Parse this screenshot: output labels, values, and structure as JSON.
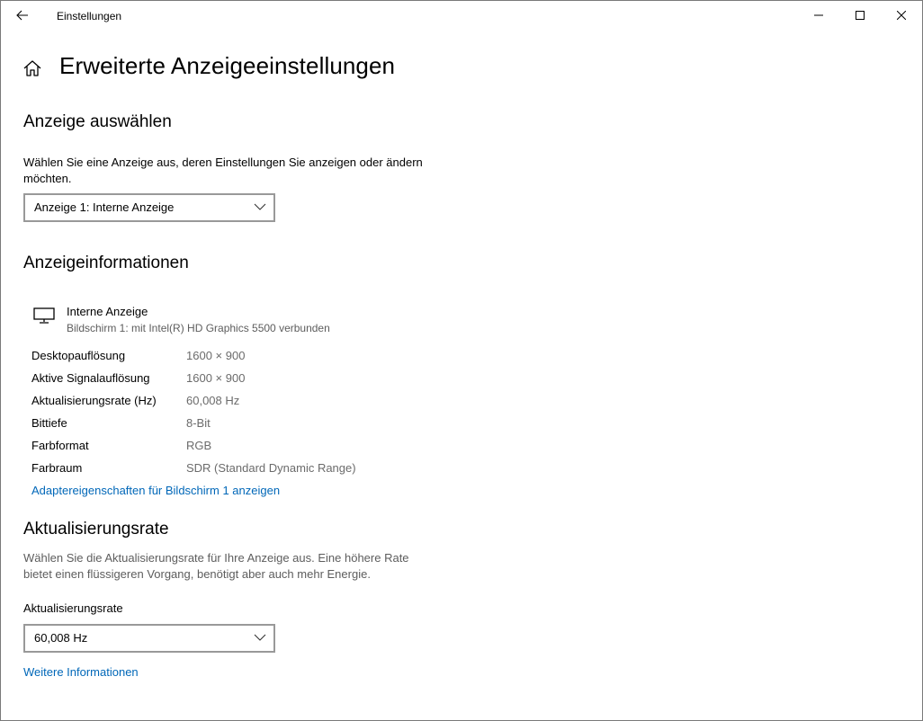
{
  "window": {
    "title": "Einstellungen"
  },
  "header": {
    "title": "Erweiterte Anzeigeeinstellungen"
  },
  "select_display": {
    "heading": "Anzeige auswählen",
    "description": "Wählen Sie eine Anzeige aus, deren Einstellungen Sie anzeigen oder ändern möchten.",
    "dropdown_value": "Anzeige 1: Interne Anzeige"
  },
  "display_info": {
    "heading": "Anzeigeinformationen",
    "display_name": "Interne Anzeige",
    "display_subtitle": "Bildschirm 1: mit Intel(R) HD Graphics 5500 verbunden",
    "rows": [
      {
        "label": "Desktopauflösung",
        "value": "1600 × 900"
      },
      {
        "label": "Aktive Signalauflösung",
        "value": "1600 × 900"
      },
      {
        "label": "Aktualisierungsrate (Hz)",
        "value": "60,008 Hz"
      },
      {
        "label": "Bittiefe",
        "value": "8-Bit"
      },
      {
        "label": "Farbformat",
        "value": "RGB"
      },
      {
        "label": "Farbraum",
        "value": "SDR (Standard Dynamic Range)"
      }
    ],
    "adapter_link": "Adaptereigenschaften für Bildschirm 1 anzeigen"
  },
  "refresh_rate": {
    "heading": "Aktualisierungsrate",
    "description": "Wählen Sie die Aktualisierungsrate für Ihre Anzeige aus. Eine höhere Rate bietet einen flüssigeren Vorgang, benötigt aber auch mehr Energie.",
    "field_label": "Aktualisierungsrate",
    "dropdown_value": "60,008 Hz",
    "more_info_link": "Weitere Informationen"
  },
  "colors": {
    "accent": "#0067b8",
    "muted_text": "#5d5d5d",
    "border": "#999999"
  },
  "icons": [
    "back-arrow-icon",
    "minimize-icon",
    "maximize-icon",
    "close-icon",
    "home-icon",
    "chevron-down-icon",
    "monitor-icon"
  ]
}
